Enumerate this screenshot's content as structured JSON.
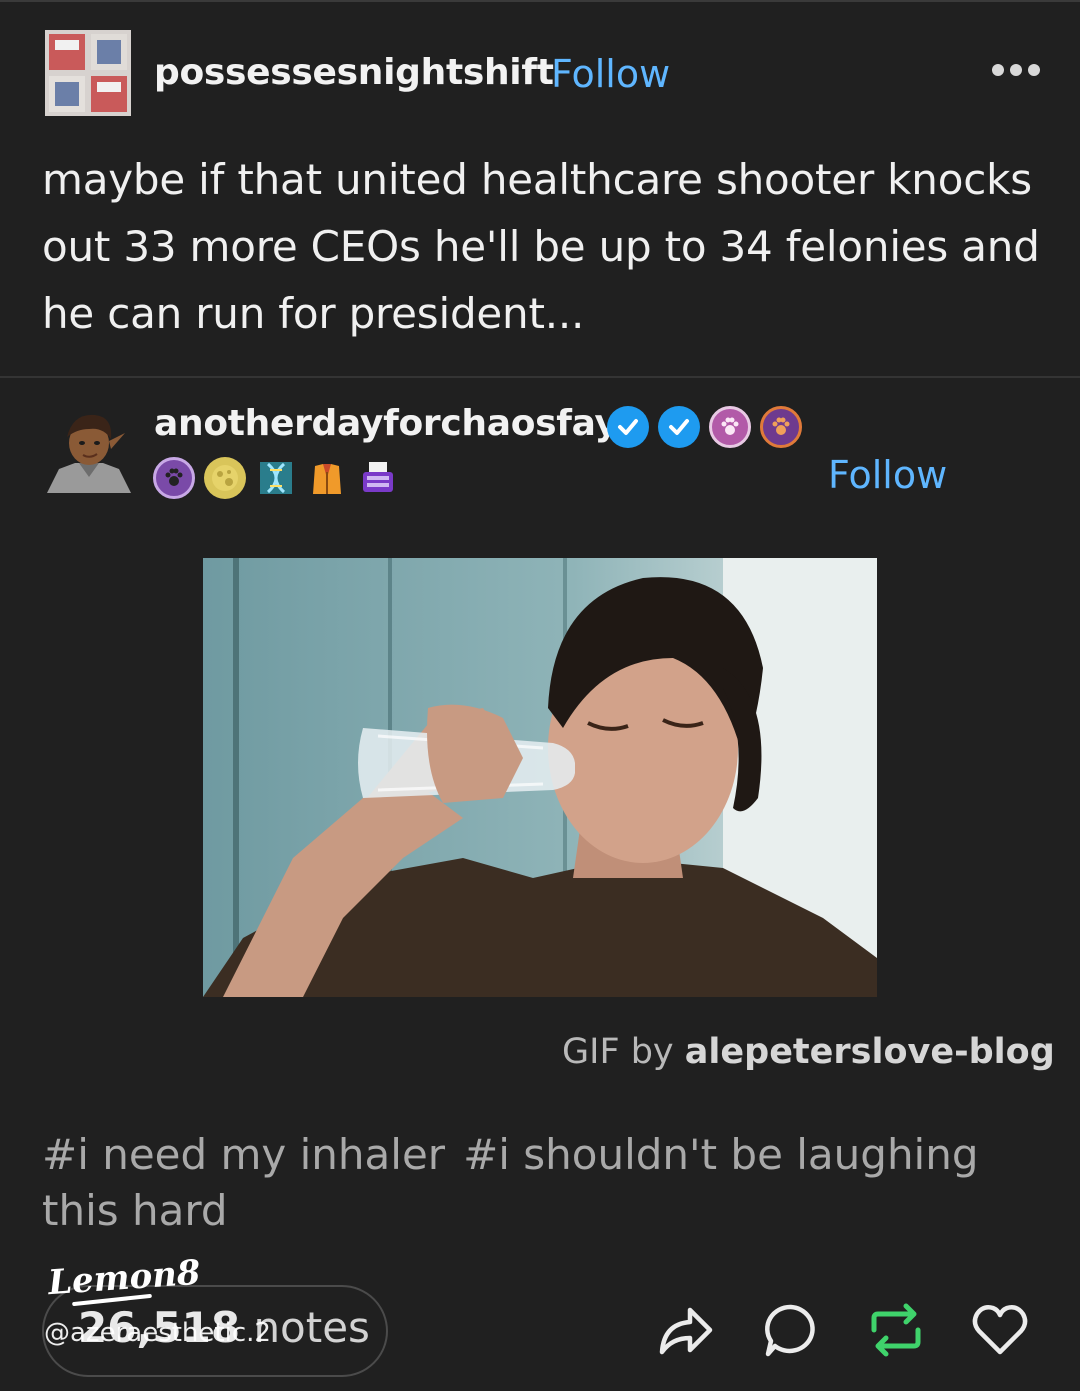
{
  "post": {
    "username": "possessesnightshift",
    "follow_label": "Follow",
    "text": "maybe if that united healthcare shooter knocks out 33 more CEOs he'll be up to 34 felonies and he can run for president..."
  },
  "reblog": {
    "username": "anotherdayforchaosfay",
    "follow_label": "Follow",
    "badge_icons": [
      "verified-badge",
      "verified-badge",
      "pink-paw-badge",
      "orange-paw-badge",
      "purple-paw-badge",
      "moon-badge",
      "dna-badge",
      "vest-badge",
      "typewriter-badge"
    ],
    "gif_credit_prefix": "GIF by",
    "gif_credit_author": "alepeterslove-blog"
  },
  "tags": [
    "#i need my inhaler",
    "#i shouldn't be laughing this hard"
  ],
  "footer": {
    "notes_count": "26,518",
    "notes_label": "notes",
    "actions": [
      "share-icon",
      "reply-icon",
      "reblog-icon",
      "like-icon"
    ]
  },
  "watermark": {
    "logo": "Lemon8",
    "handle": "@azeraesthetic.2"
  },
  "colors": {
    "background": "#202020",
    "follow_blue": "#5fb6ff",
    "reblog_green": "#3fd36b",
    "verified_blue": "#1e9bf0"
  }
}
